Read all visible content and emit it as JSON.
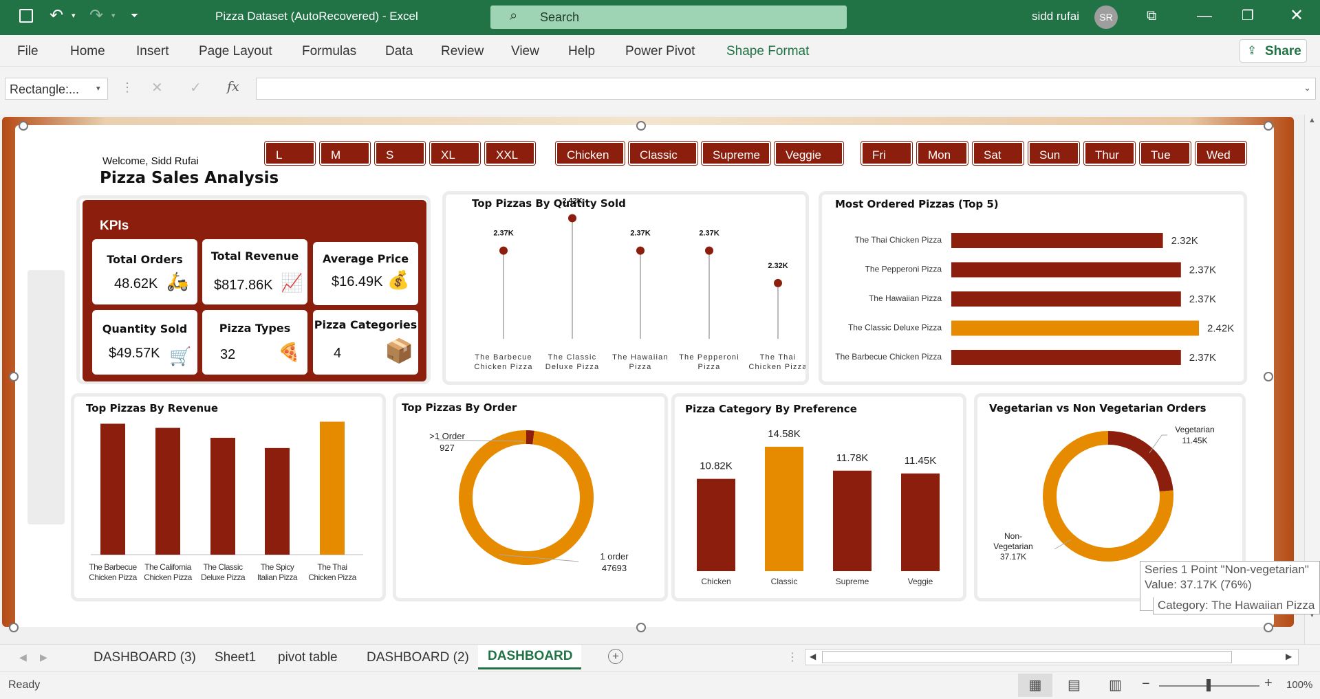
{
  "window": {
    "title": "Pizza Dataset (AutoRecovered)  -  Excel",
    "search_placeholder": "Search",
    "user": "sidd rufai",
    "user_initials": "SR"
  },
  "menu": [
    "File",
    "Home",
    "Insert",
    "Page Layout",
    "Formulas",
    "Data",
    "Review",
    "View",
    "Help",
    "Power Pivot",
    "Shape Format"
  ],
  "share_label": "Share",
  "formula_bar": {
    "name_box": "Rectangle:...",
    "fx": "fx",
    "formula": ""
  },
  "dashboard": {
    "welcome": "Welcome, Sidd Rufai",
    "title": "Pizza Sales Analysis",
    "slicers": {
      "sizes": [
        "L",
        "M",
        "S",
        "XL",
        "XXL"
      ],
      "categories": [
        "Chicken",
        "Classic",
        "Supreme",
        "Veggie"
      ],
      "days": [
        "Fri",
        "Mon",
        "Sat",
        "Sun",
        "Thur",
        "Tue",
        "Wed"
      ]
    },
    "kpi_title": "KPIs",
    "kpis": [
      {
        "label": "Total Orders",
        "value": "48.62K",
        "icon": "delivery-person-icon"
      },
      {
        "label": "Total Revenue",
        "value": "$817.86K",
        "icon": "growth-chart-icon"
      },
      {
        "label": "Average Price",
        "value": "$16.49K",
        "icon": "money-hand-icon"
      },
      {
        "label": "Quantity Sold",
        "value": "$49.57K",
        "icon": "shopping-cart-icon"
      },
      {
        "label": "Pizza Types",
        "value": "32",
        "icon": "pizza-icon"
      },
      {
        "label": "Pizza Categories",
        "value": "4",
        "icon": "pizza-box-icon"
      }
    ],
    "colors": {
      "maroon": "#8b1e0c",
      "orange": "#e68a00",
      "kpi_bg": "#8b1e0c"
    }
  },
  "chart_data": [
    {
      "type": "lollipop",
      "title": "Top Pizzas By Quatity Sold",
      "categories": [
        "The Barbecue Chicken Pizza",
        "The Classic Deluxe Pizza",
        "The Hawaiian Pizza",
        "The Pepperoni Pizza",
        "The Thai Chicken Pizza"
      ],
      "values": [
        2.37,
        2.42,
        2.37,
        2.37,
        2.32
      ],
      "labels": [
        "2.37K",
        "2.42K",
        "2.37K",
        "2.37K",
        "2.32K"
      ],
      "unit": "K"
    },
    {
      "type": "bar",
      "orientation": "horizontal",
      "title": "Most Ordered Pizzas (Top 5)",
      "categories": [
        "The Thai Chicken Pizza",
        "The Pepperoni Pizza",
        "The Hawaiian Pizza",
        "The Classic Deluxe Pizza",
        "The Barbecue Chicken Pizza"
      ],
      "values": [
        2.32,
        2.37,
        2.37,
        2.42,
        2.37
      ],
      "labels": [
        "2.32K",
        "2.37K",
        "2.37K",
        "2.42K",
        "2.37K"
      ],
      "highlight_index": 3
    },
    {
      "type": "bar",
      "title": "Top Pizzas By Revenue",
      "categories": [
        "The Barbecue Chicken Pizza",
        "The California Chicken Pizza",
        "The Classic Deluxe Pizza",
        "The Spicy Italian Pizza",
        "The Thai Chicken Pizza"
      ],
      "values": [
        42768,
        41409,
        38180,
        34831,
        43434
      ],
      "highlight_index": 4
    },
    {
      "type": "pie",
      "title": "Top Pizzas By Order",
      "slices": [
        {
          "label": ">1 Order",
          "value": 927
        },
        {
          "label": "1 order",
          "value": 47693
        }
      ]
    },
    {
      "type": "bar",
      "title": "Pizza Category By Preference",
      "categories": [
        "Chicken",
        "Classic",
        "Supreme",
        "Veggie"
      ],
      "values": [
        10.82,
        14.58,
        11.78,
        11.45
      ],
      "labels": [
        "10.82K",
        "14.58K",
        "11.78K",
        "11.45K"
      ],
      "highlight_index": 1
    },
    {
      "type": "pie",
      "title": "Vegetarian vs Non Vegetarian Orders",
      "slices": [
        {
          "label": "Vegetarian",
          "value": 11.45,
          "display": "11.45K"
        },
        {
          "label": "Non-Vegetarian",
          "value": 37.17,
          "display": "37.17K"
        }
      ]
    }
  ],
  "tooltip": [
    "Series 1 Point \"Non-vegetarian\"",
    "Value: 37.17K (76%)",
    "Category: The Hawaiian Pizza"
  ],
  "sheet_tabs": [
    "DASHBOARD (3)",
    "Sheet1",
    "pivot table",
    "DASHBOARD (2)",
    "DASHBOARD"
  ],
  "active_tab": "DASHBOARD",
  "status": {
    "ready": "Ready",
    "zoom": "100%"
  }
}
